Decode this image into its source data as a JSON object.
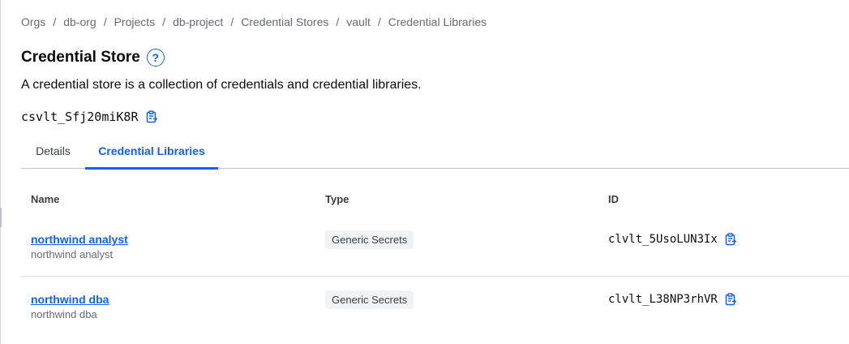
{
  "breadcrumb": [
    {
      "label": "Orgs"
    },
    {
      "label": "db-org"
    },
    {
      "label": "Projects"
    },
    {
      "label": "db-project"
    },
    {
      "label": "Credential Stores"
    },
    {
      "label": "vault"
    },
    {
      "label": "Credential Libraries"
    }
  ],
  "breadcrumb_separator": "/",
  "header": {
    "title": "Credential Store",
    "help_icon": "question-circle-icon",
    "help_glyph": "?",
    "description": "A credential store is a collection of credentials and credential libraries.",
    "store_id": "csvlt_Sfj20miK8R"
  },
  "tabs": [
    {
      "label": "Details",
      "active": false
    },
    {
      "label": "Credential Libraries",
      "active": true
    }
  ],
  "table": {
    "columns": [
      "Name",
      "Type",
      "ID"
    ],
    "rows": [
      {
        "name": "northwind analyst",
        "subtitle": "northwind analyst",
        "type": "Generic Secrets",
        "id": "clvlt_5UsoLUN3Ix"
      },
      {
        "name": "northwind dba",
        "subtitle": "northwind dba",
        "type": "Generic Secrets",
        "id": "clvlt_L38NP3rhVR"
      }
    ]
  },
  "colors": {
    "accent": "#1060ff",
    "muted_text": "#656a76",
    "badge_bg": "#f1f2f3"
  }
}
